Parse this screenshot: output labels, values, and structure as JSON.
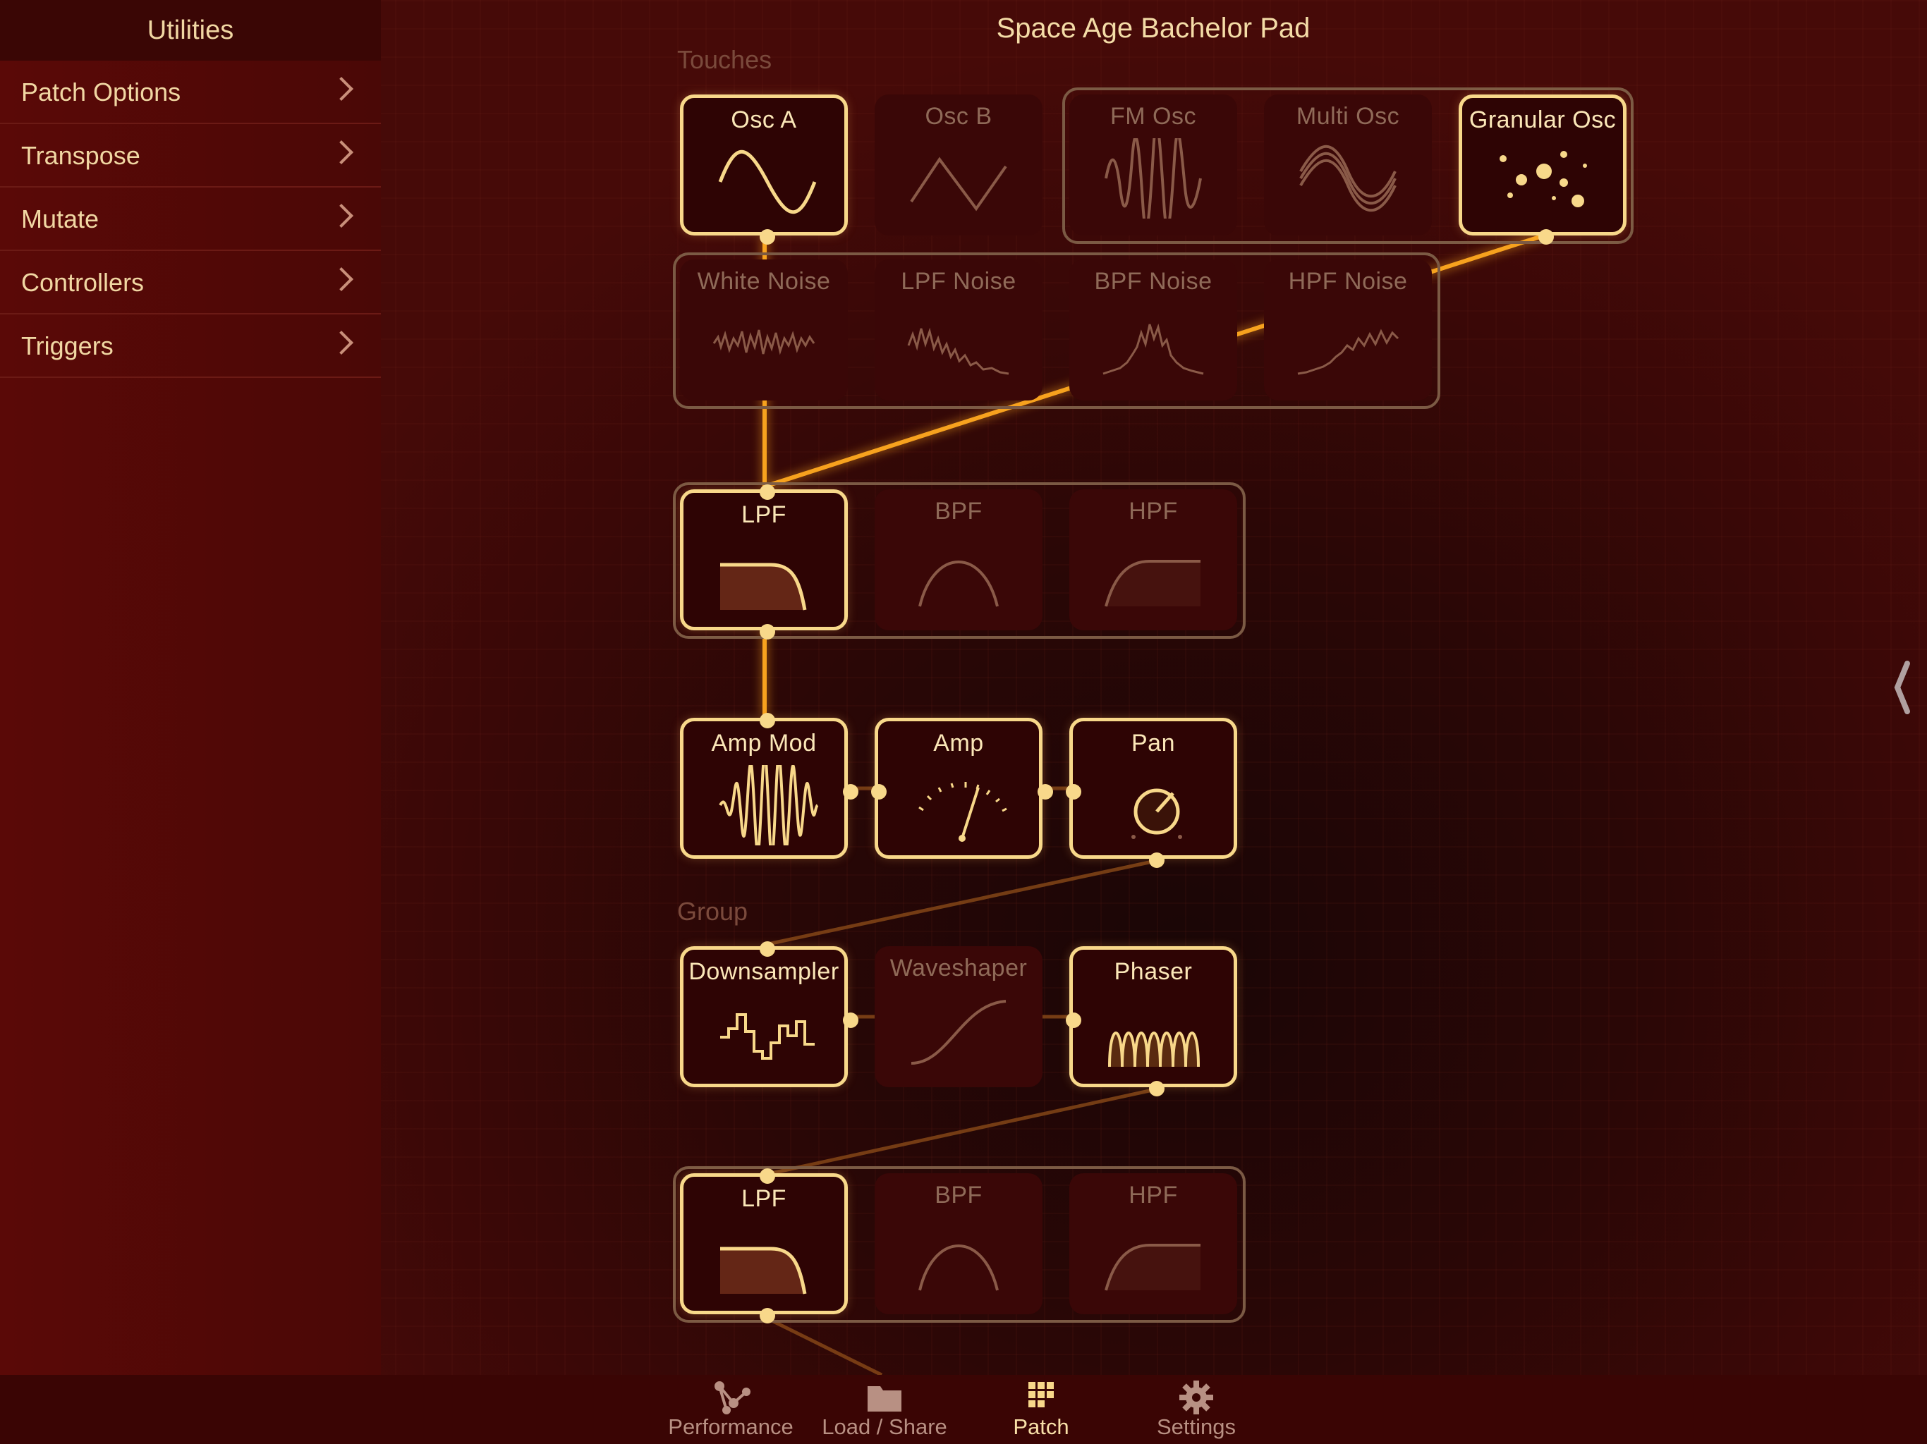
{
  "app": {
    "title": "Space Age Bachelor Pad"
  },
  "sidebar": {
    "header": "Utilities",
    "items": [
      {
        "label": "Patch Options"
      },
      {
        "label": "Transpose"
      },
      {
        "label": "Mutate"
      },
      {
        "label": "Controllers"
      },
      {
        "label": "Triggers"
      }
    ]
  },
  "sections": {
    "touches": "Touches",
    "group": "Group"
  },
  "modules": {
    "osc_a": "Osc A",
    "osc_b": "Osc B",
    "fm_osc": "FM Osc",
    "multi_osc": "Multi Osc",
    "granular_osc": "Granular Osc",
    "white_noise": "White Noise",
    "lpf_noise": "LPF Noise",
    "bpf_noise": "BPF Noise",
    "hpf_noise": "HPF Noise",
    "lpf1": "LPF",
    "bpf1": "BPF",
    "hpf1": "HPF",
    "amp_mod": "Amp Mod",
    "amp": "Amp",
    "pan": "Pan",
    "downsampler": "Downsampler",
    "waveshaper": "Waveshaper",
    "phaser": "Phaser",
    "lpf2": "LPF",
    "bpf2": "BPF",
    "hpf2": "HPF"
  },
  "tabbar": {
    "tabs": [
      {
        "label": "Performance",
        "icon": "share-nodes-icon"
      },
      {
        "label": "Load / Share",
        "icon": "folder-icon"
      },
      {
        "label": "Patch",
        "icon": "grid-icon"
      },
      {
        "label": "Settings",
        "icon": "gear-icon"
      }
    ],
    "selected": "Patch"
  },
  "colors": {
    "accent": "#f8d88a",
    "wire": "#f7a21e",
    "background": "#2a0706"
  }
}
